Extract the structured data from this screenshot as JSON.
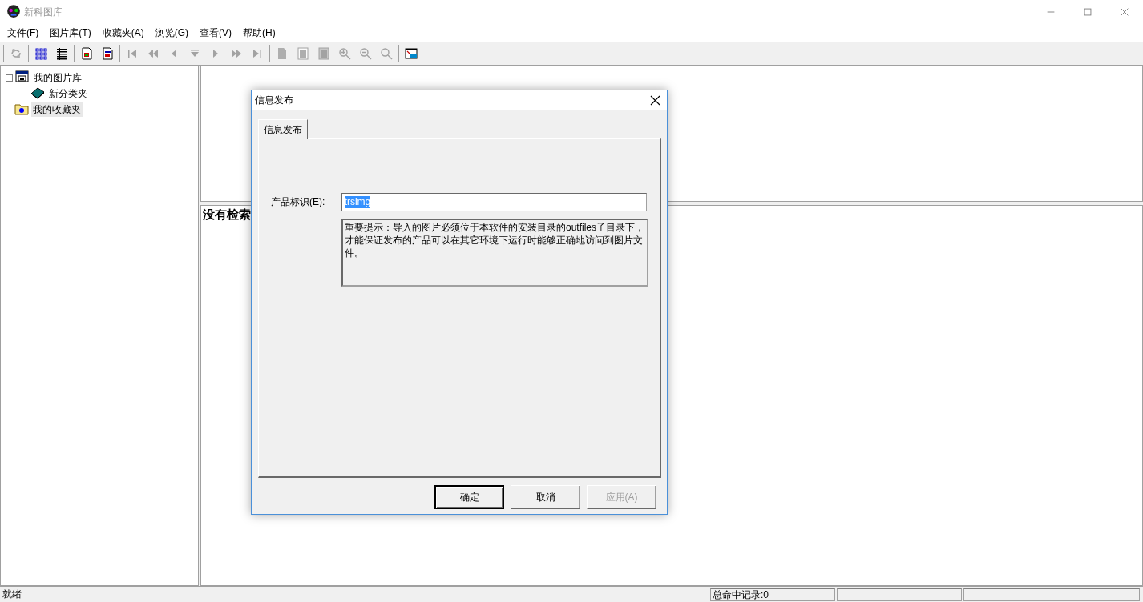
{
  "window": {
    "title": "新科图库",
    "active": false
  },
  "menu": [
    {
      "label": "文件(F)"
    },
    {
      "label": "图片库(T)"
    },
    {
      "label": "收藏夹(A)"
    },
    {
      "label": "浏览(G)"
    },
    {
      "label": "查看(V)"
    },
    {
      "label": "帮助(H)"
    }
  ],
  "toolbar": [
    [
      {
        "disabled": true
      }
    ],
    [
      {
        "disabled": false
      },
      {
        "disabled": false
      }
    ],
    [
      {
        "disabled": false
      },
      {
        "disabled": false
      }
    ],
    [
      {
        "disabled": true
      },
      {
        "disabled": true
      },
      {
        "disabled": true
      },
      {
        "disabled": true
      },
      {
        "disabled": true
      },
      {
        "disabled": true
      },
      {
        "disabled": true
      }
    ],
    [
      {
        "disabled": true
      },
      {
        "disabled": true
      },
      {
        "disabled": true
      },
      {
        "disabled": true
      },
      {
        "disabled": true
      },
      {
        "disabled": true
      }
    ],
    [
      {
        "disabled": false
      }
    ]
  ],
  "tree": [
    {
      "label": "我的图片库",
      "kind": "library",
      "expanded": true,
      "selected": false,
      "children": [
        {
          "label": "新分类夹",
          "kind": "book",
          "selected": false
        }
      ]
    },
    {
      "label": "我的收藏夹",
      "kind": "favorites",
      "selected": true
    }
  ],
  "results": {
    "message": "没有检索"
  },
  "dialog": {
    "title": "信息发布",
    "tabs": [
      {
        "label": "信息发布",
        "selected": true
      }
    ],
    "field": {
      "label": "产品标识(E):",
      "value": "trsimg",
      "text_selected": true
    },
    "note": "重要提示：导入的图片必须位于本软件的安装目录的outfiles子目录下，才能保证发布的产品可以在其它环境下运行时能够正确地访问到图片文件。",
    "buttons": [
      {
        "label": "确定",
        "default": true,
        "disabled": false
      },
      {
        "label": "取消",
        "default": false,
        "disabled": false
      },
      {
        "label": "应用(A)",
        "default": false,
        "disabled": true
      }
    ]
  },
  "status_bar": {
    "message": "就绪",
    "panels": [
      "总命中记录:0"
    ]
  }
}
